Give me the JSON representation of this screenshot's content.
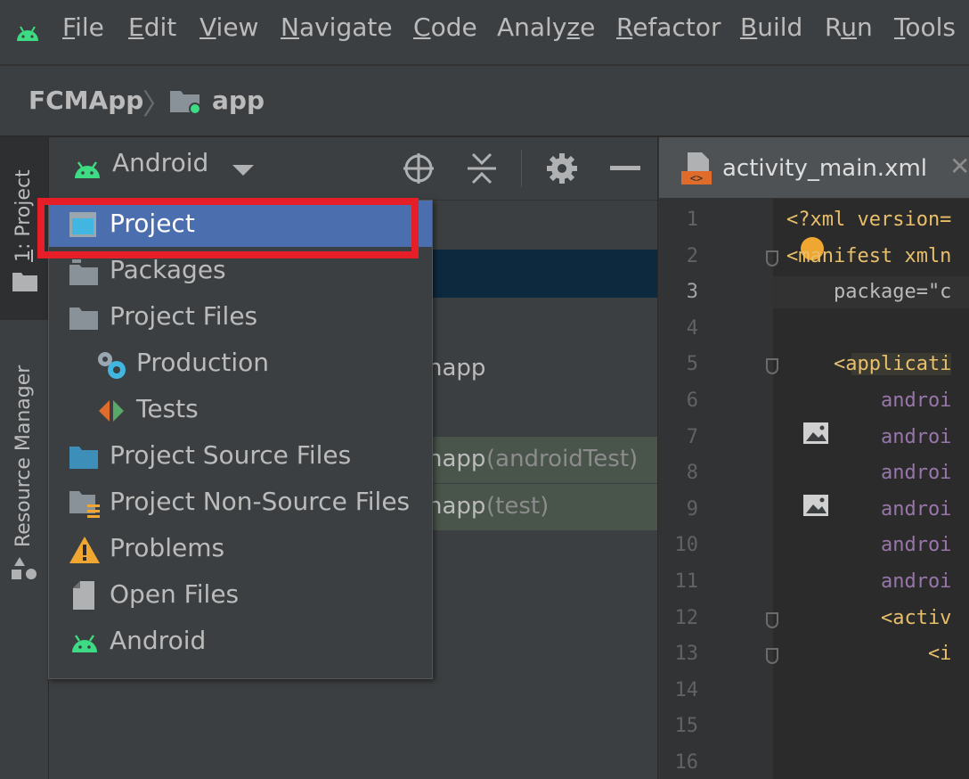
{
  "menubar": {
    "items": [
      {
        "label": "File",
        "u": "F",
        "rest": "ile"
      },
      {
        "label": "Edit",
        "u": "E",
        "rest": "dit"
      },
      {
        "label": "View",
        "u": "V",
        "rest": "iew"
      },
      {
        "label": "Navigate",
        "u": "N",
        "rest": "avigate"
      },
      {
        "label": "Code",
        "u": "C",
        "rest": "ode"
      },
      {
        "label": "Analyze",
        "pre": "Analy",
        "u": "z",
        "rest": "e"
      },
      {
        "label": "Refactor",
        "u": "R",
        "rest": "efactor"
      },
      {
        "label": "Build",
        "u": "B",
        "rest": "uild"
      },
      {
        "label": "Run",
        "pre": "R",
        "u": "u",
        "rest": "n"
      },
      {
        "label": "Tools",
        "u": "T",
        "rest": "ools"
      }
    ]
  },
  "breadcrumb": {
    "project": "FCMApp",
    "module": "app"
  },
  "left_tools": {
    "project_tab": "1: Project",
    "project_tab_num": "1",
    "project_tab_rest": ": Project",
    "resource_tab": "Resource Manager"
  },
  "project_panel": {
    "view_selector": "Android",
    "icons": [
      "locate-icon",
      "collapse-all-icon",
      "gear-icon",
      "minimize-icon"
    ],
    "visible_rows": [
      {
        "text": "napp",
        "suffix": ""
      },
      {
        "text": "napp",
        "suffix": " (androidTest)"
      },
      {
        "text": "napp",
        "suffix": " (test)"
      }
    ]
  },
  "editor": {
    "tab_title": "activity_main.xml",
    "line_numbers": [
      "1",
      "2",
      "3",
      "4",
      "5",
      "6",
      "7",
      "8",
      "9",
      "10",
      "11",
      "12",
      "13",
      "14",
      "15",
      "16"
    ],
    "lines": [
      {
        "t": "<?xml version="
      },
      {
        "t": "<manifest xmln"
      },
      {
        "t": "    package=\"c"
      },
      {
        "t": ""
      },
      {
        "t": "    <applicati"
      },
      {
        "t": "        androi"
      },
      {
        "t": "        androi"
      },
      {
        "t": "        androi"
      },
      {
        "t": "        androi"
      },
      {
        "t": "        androi"
      },
      {
        "t": "        androi"
      },
      {
        "t": "        <activ"
      },
      {
        "t": "            <i"
      },
      {
        "t": ""
      },
      {
        "t": ""
      },
      {
        "t": ""
      }
    ]
  },
  "popup": {
    "items": [
      {
        "label": "Project",
        "icon": "project-window-icon",
        "selected": true
      },
      {
        "label": "Packages",
        "icon": "packages-folder-icon"
      },
      {
        "label": "Project Files",
        "icon": "folder-icon"
      },
      {
        "label": "Production",
        "icon": "production-gear-icon",
        "indent": true
      },
      {
        "label": "Tests",
        "icon": "tests-arrows-icon",
        "indent": true
      },
      {
        "label": "Project Source Files",
        "icon": "source-folder-icon"
      },
      {
        "label": "Project Non-Source Files",
        "icon": "non-source-folder-icon"
      },
      {
        "label": "Problems",
        "icon": "warning-icon"
      },
      {
        "label": "Open Files",
        "icon": "open-file-icon"
      },
      {
        "label": "Android",
        "icon": "android-icon"
      }
    ]
  },
  "colors": {
    "accent_selected": "#4b6eaf",
    "highlight_border": "#e61e28",
    "android_green": "#3ddc84"
  }
}
